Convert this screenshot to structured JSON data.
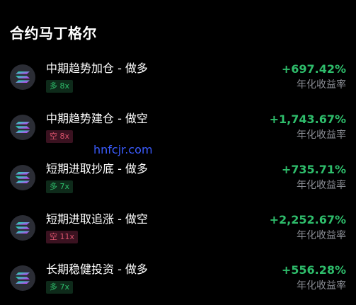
{
  "section": {
    "title": "合约马丁格尔"
  },
  "watermark": {
    "text": "hnfcjr.com"
  },
  "colors": {
    "background": "#000000",
    "profit_green": "#2ebd6b",
    "short_red": "#d9526b",
    "muted_gray": "#8a8d94",
    "watermark_blue": "#3b5cff"
  },
  "icon": "solana-coin-icon",
  "strategies": [
    {
      "name": "中期趋势加仓 - 做多",
      "badge": "多 8x",
      "direction": "long",
      "return": "+697.42%",
      "return_label": "年化收益率"
    },
    {
      "name": "中期趋势建仓 - 做空",
      "badge": "空 8x",
      "direction": "short",
      "return": "+1,743.67%",
      "return_label": "年化收益率"
    },
    {
      "name": "短期进取抄底 - 做多",
      "badge": "多 7x",
      "direction": "long",
      "return": "+735.71%",
      "return_label": "年化收益率"
    },
    {
      "name": "短期进取追涨 - 做空",
      "badge": "空 11x",
      "direction": "short",
      "return": "+2,252.67%",
      "return_label": "年化收益率"
    },
    {
      "name": "长期稳健投资 - 做多",
      "badge": "多 7x",
      "direction": "long",
      "return": "+556.28%",
      "return_label": "年化收益率"
    }
  ]
}
